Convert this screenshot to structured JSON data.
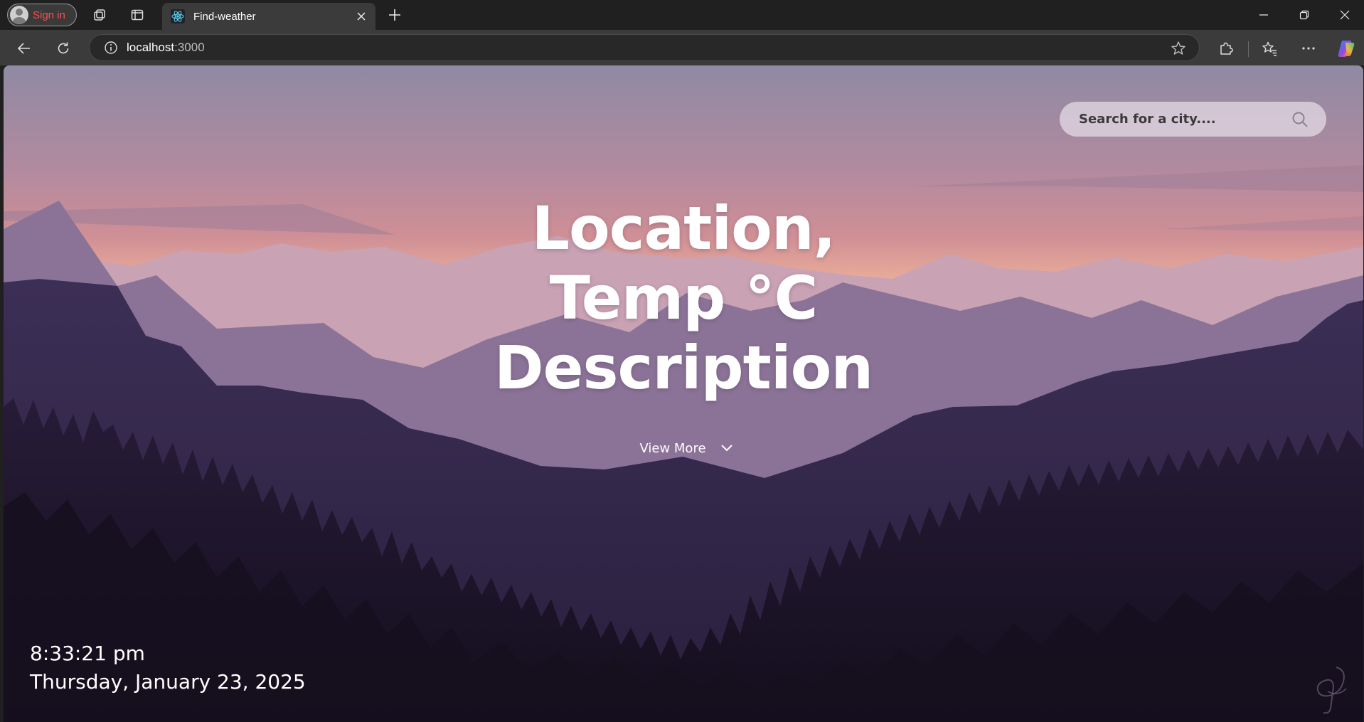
{
  "browser": {
    "profile_label": "Sign in",
    "tab_title": "Find-weather",
    "url_host": "localhost",
    "url_port": ":3000"
  },
  "page": {
    "search": {
      "placeholder": "Search for a city...."
    },
    "headline": {
      "line1": "Location,",
      "line2": "Temp °C",
      "line3": "Description"
    },
    "view_more_label": "View More",
    "clock": {
      "time": "8:33:21 pm",
      "date": "Thursday, January 23, 2025"
    }
  },
  "icons": {
    "tab_favicon": "react-icon",
    "search": "search-icon",
    "view_more": "chevron-down-icon"
  },
  "colors": {
    "sky_top": "#8f8aa3",
    "sky_glow": "#f0b8a2",
    "far_mountains": "#c8a2b5",
    "mid_mountains": "#8e7499",
    "near_mountains": "#3b2d53",
    "forest": "#1f162e",
    "profile_text": "#ff4d4d"
  }
}
